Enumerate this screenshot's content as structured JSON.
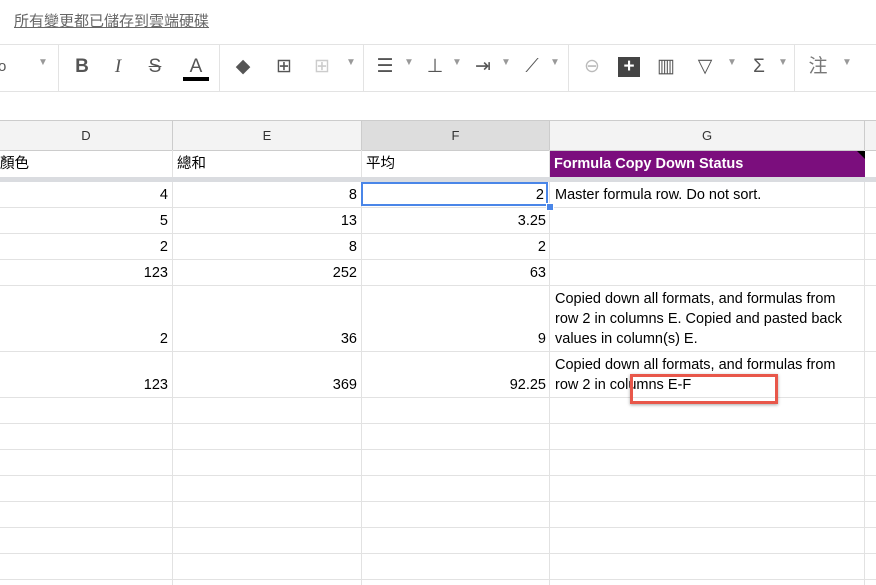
{
  "status": {
    "saved_text": "所有變更都已儲存到雲端硬碟"
  },
  "toolbar": {
    "font_size_partial": "o",
    "items": [
      "bold-icon",
      "italic-icon",
      "strikethrough-icon",
      "text-color-icon",
      "fill-color-icon",
      "borders-icon",
      "merge-cells-icon",
      "align-horizontal-icon",
      "align-vertical-icon",
      "text-wrap-icon",
      "text-rotation-icon",
      "link-icon",
      "comment-icon",
      "chart-icon",
      "filter-icon",
      "functions-icon",
      "input-tools-icon"
    ],
    "bold": "B",
    "italic": "I",
    "strike": "S",
    "textcolor": "A",
    "sigma": "Σ",
    "ime": "注",
    "text_color": "#000000"
  },
  "columns": [
    "D",
    "E",
    "F",
    "G"
  ],
  "header_row": {
    "d": "顏色",
    "e": "總和",
    "f": "平均",
    "g": "Formula Copy Down Status",
    "g_bg": "#7b0e7d"
  },
  "rows": [
    {
      "d": "4",
      "e": "8",
      "f": "2",
      "g": "Master formula row. Do not sort."
    },
    {
      "d": "5",
      "e": "13",
      "f": "3.25",
      "g": ""
    },
    {
      "d": "2",
      "e": "8",
      "f": "2",
      "g": ""
    },
    {
      "d": "123",
      "e": "252",
      "f": "63",
      "g": ""
    },
    {
      "d": "2",
      "e": "36",
      "f": "9",
      "g": "Copied down all formats, and formulas from row 2 in columns E. Copied and pasted back values in column(s) E."
    },
    {
      "d": "123",
      "e": "369",
      "f": "92.25",
      "g": "Copied down all formats, and formulas from row 2 in columns E-F"
    }
  ],
  "highlight_color": "#e8574a"
}
